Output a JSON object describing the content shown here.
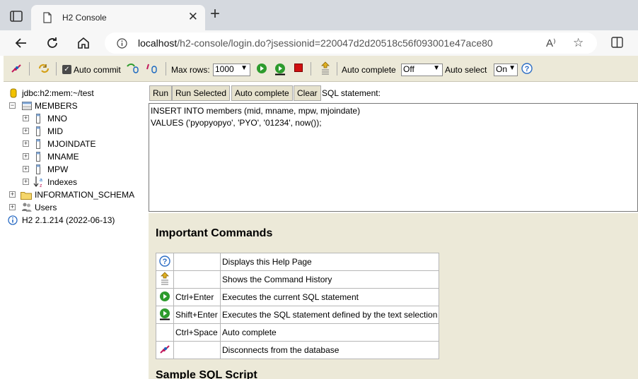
{
  "browser": {
    "tab_title": "H2 Console",
    "close_symbol": "✕",
    "new_tab_symbol": "+",
    "url_host": "localhost",
    "url_path": "/h2-console/login.do?jsessionid=220047d2d20518c56f093001e47ace80",
    "read_aloud_symbol": "A⁾",
    "favorite_symbol": "☆"
  },
  "toolbar": {
    "auto_commit_label": "Auto commit",
    "max_rows_label": "Max rows:",
    "max_rows_value": "1000",
    "auto_complete_label": "Auto complete",
    "auto_complete_value": "Off",
    "auto_select_label": "Auto select",
    "auto_select_value": "On"
  },
  "tree": {
    "connection": "jdbc:h2:mem:~/test",
    "table": "MEMBERS",
    "columns": [
      "MNO",
      "MID",
      "MJOINDATE",
      "MNAME",
      "MPW"
    ],
    "indexes": "Indexes",
    "info_schema": "INFORMATION_SCHEMA",
    "users": "Users",
    "version": "H2 2.1.214 (2022-06-13)"
  },
  "query": {
    "run": "Run",
    "run_selected": "Run Selected",
    "auto_complete": "Auto complete",
    "clear": "Clear",
    "sql_label": "SQL statement:",
    "sql_text": "INSERT INTO members (mid, mname, mpw, mjoindate)\nVALUES ('pyopyopyo', 'PYO', '01234', now());"
  },
  "help": {
    "title": "Important Commands",
    "rows": [
      {
        "icon": "help-icon",
        "key": "",
        "desc": "Displays this Help Page"
      },
      {
        "icon": "history-icon",
        "key": "",
        "desc": "Shows the Command History"
      },
      {
        "icon": "run-icon",
        "key": "Ctrl+Enter",
        "desc": "Executes the current SQL statement"
      },
      {
        "icon": "run-selected-icon",
        "key": "Shift+Enter",
        "desc": "Executes the SQL statement defined by the text selection"
      },
      {
        "icon": "",
        "key": "Ctrl+Space",
        "desc": "Auto complete"
      },
      {
        "icon": "disconnect-icon",
        "key": "",
        "desc": "Disconnects from the database"
      }
    ],
    "sample_title": "Sample SQL Script"
  },
  "colors": {
    "toolbar_bg": "#ece9d8",
    "browser_frame": "#d5d9df",
    "run_green": "#2d9b2d",
    "stop_red": "#d01010",
    "help_blue": "#2b6cc4"
  }
}
